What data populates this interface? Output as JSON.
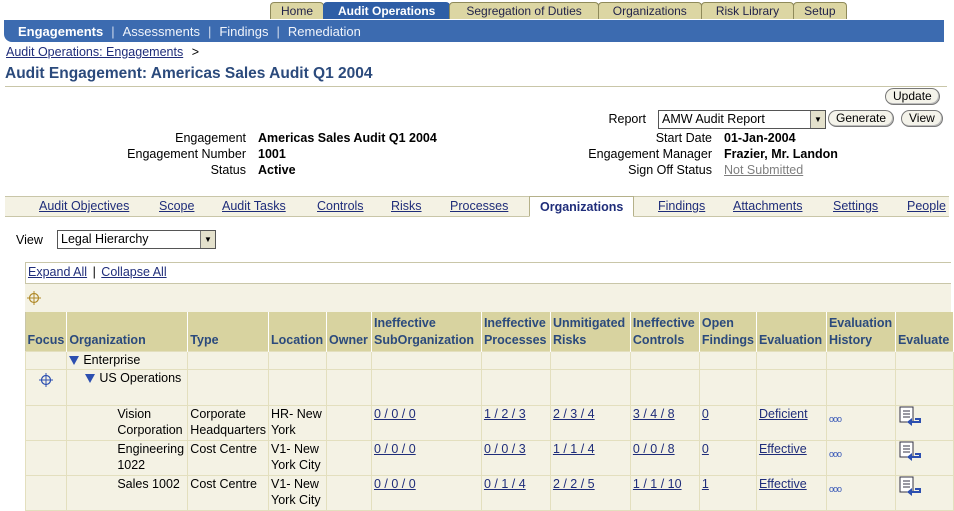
{
  "global_tabs": [
    "Home",
    "Audit Operations",
    "Segregation of Duties",
    "Organizations",
    "Risk Library",
    "Setup"
  ],
  "nav_bar": {
    "current": "Engagements",
    "items": [
      "Assessments",
      "Findings",
      "Remediation"
    ]
  },
  "breadcrumb": {
    "link": "Audit Operations: Engagements",
    "sep": ">"
  },
  "page_title": "Audit Engagement: Americas Sales Audit Q1 2004",
  "buttons": {
    "update": "Update",
    "generate": "Generate",
    "view": "View"
  },
  "report": {
    "label": "Report",
    "selected": "AMW Audit Report"
  },
  "details": {
    "engagement_label": "Engagement",
    "engagement": "Americas Sales Audit Q1 2004",
    "number_label": "Engagement Number",
    "number": "1001",
    "status_label": "Status",
    "status": "Active",
    "start_label": "Start Date",
    "start": "01-Jan-2004",
    "manager_label": "Engagement Manager",
    "manager": "Frazier, Mr. Landon",
    "signoff_label": "Sign Off Status",
    "signoff": "Not Submitted"
  },
  "sub_tabs": [
    "Audit Objectives",
    "Scope",
    "Audit Tasks",
    "Controls",
    "Risks",
    "Processes",
    "Organizations",
    "Findings",
    "Attachments",
    "Settings",
    "People"
  ],
  "view": {
    "label": "View",
    "selected": "Legal Hierarchy"
  },
  "tree_actions": {
    "expand": "Expand All",
    "sep": "|",
    "collapse": "Collapse All"
  },
  "table": {
    "headers": [
      "Focus",
      "Organization",
      "Type",
      "Location",
      "Owner",
      "Ineffective SubOrganization",
      "Ineffective Processes",
      "Unmitigated Risks",
      "Ineffective Controls",
      "Open Findings",
      "Evaluation",
      "Evaluation History",
      "Evaluate"
    ],
    "tree_rows": [
      {
        "label": "Enterprise"
      },
      {
        "label": "US Operations"
      }
    ],
    "rows": [
      {
        "org": "Vision Corporation",
        "type": "Corporate Headquarters",
        "location": "HR- New York",
        "owner": "",
        "subs": "0 / 0 / 0",
        "procs": "1 / 2 / 3",
        "risks": "2 / 3 / 4",
        "controls": "3 / 4 / 8",
        "findings": "0",
        "evaluation": "Deficient"
      },
      {
        "org": "Engineering 1022",
        "type": "Cost Centre",
        "location": "V1- New York City",
        "owner": "",
        "subs": "0 / 0 / 0",
        "procs": "0 / 0 / 3",
        "risks": "1 / 1 / 4",
        "controls": "0 / 0 / 8",
        "findings": "0",
        "evaluation": "Effective"
      },
      {
        "org": "Sales 1002",
        "type": "Cost Centre",
        "location": "V1- New York City",
        "owner": "",
        "subs": "0 / 0 / 0",
        "procs": "0 / 1 / 4",
        "risks": "2 / 2 / 5",
        "controls": "1 / 1 / 10",
        "findings": "1",
        "evaluation": "Effective"
      }
    ]
  },
  "colors": {
    "accent": "#3c6bb0",
    "header_bg": "#d8d3a0",
    "tab_bg": "#dcd6a3",
    "link": "#1f2d7a"
  }
}
